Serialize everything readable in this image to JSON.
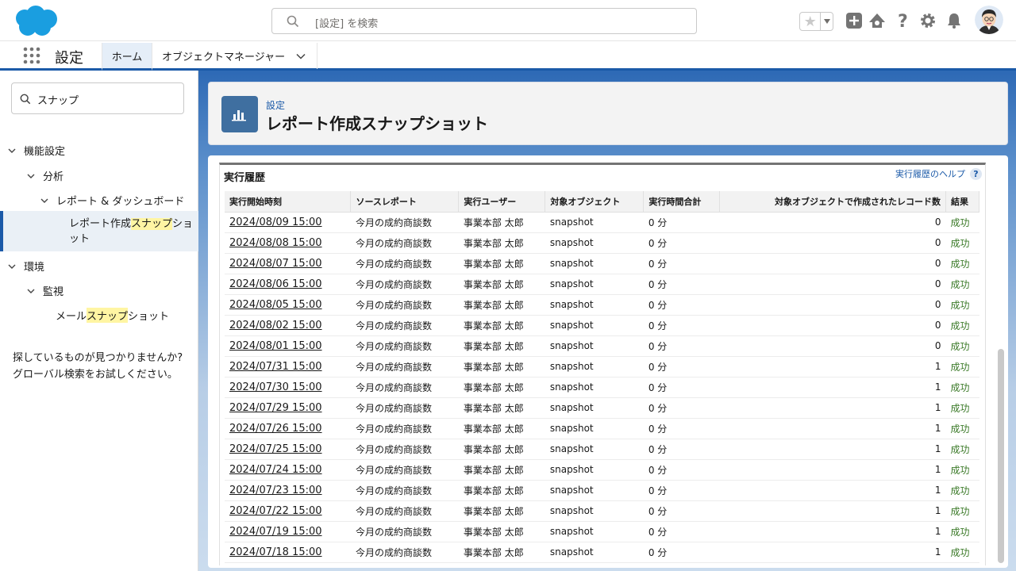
{
  "header": {
    "search_placeholder": "[設定] を検索"
  },
  "appnav": {
    "app_name": "設定",
    "tabs": [
      {
        "label": "ホーム"
      },
      {
        "label": "オブジェクトマネージャー"
      }
    ]
  },
  "sidebar": {
    "quick_find_value": "スナップ",
    "tree": {
      "features": "機能設定",
      "analytics": "分析",
      "reports_dashboards": "レポート & ダッシュボード",
      "selected_pre": "レポート作成",
      "selected_hl": "スナップ",
      "selected_post": "ショット",
      "environment": "環境",
      "monitoring": "監視",
      "email_pre": "メール",
      "email_hl": "スナップ",
      "email_post": "ショット"
    },
    "not_found_line1": "探しているものが見つかりませんか?",
    "not_found_line2": "グローバル検索をお試しください。"
  },
  "page": {
    "breadcrumb": "設定",
    "title": "レポート作成スナップショット"
  },
  "history": {
    "title": "実行履歴",
    "help_label": "実行履歴のヘルプ",
    "help_glyph": "?",
    "columns": [
      "実行開始時刻",
      "ソースレポート",
      "実行ユーザー",
      "対象オブジェクト",
      "実行時間合計",
      "対象オブジェクトで作成されたレコード数",
      "結果"
    ],
    "rows": [
      {
        "start": "2024/08/09 15:00",
        "report": "今月の成約商談数",
        "user": "事業本部 太郎",
        "object": "snapshot",
        "duration": "0 分",
        "records": "0",
        "result": "成功"
      },
      {
        "start": "2024/08/08 15:00",
        "report": "今月の成約商談数",
        "user": "事業本部 太郎",
        "object": "snapshot",
        "duration": "0 分",
        "records": "0",
        "result": "成功"
      },
      {
        "start": "2024/08/07 15:00",
        "report": "今月の成約商談数",
        "user": "事業本部 太郎",
        "object": "snapshot",
        "duration": "0 分",
        "records": "0",
        "result": "成功"
      },
      {
        "start": "2024/08/06 15:00",
        "report": "今月の成約商談数",
        "user": "事業本部 太郎",
        "object": "snapshot",
        "duration": "0 分",
        "records": "0",
        "result": "成功"
      },
      {
        "start": "2024/08/05 15:00",
        "report": "今月の成約商談数",
        "user": "事業本部 太郎",
        "object": "snapshot",
        "duration": "0 分",
        "records": "0",
        "result": "成功"
      },
      {
        "start": "2024/08/02 15:00",
        "report": "今月の成約商談数",
        "user": "事業本部 太郎",
        "object": "snapshot",
        "duration": "0 分",
        "records": "0",
        "result": "成功"
      },
      {
        "start": "2024/08/01 15:00",
        "report": "今月の成約商談数",
        "user": "事業本部 太郎",
        "object": "snapshot",
        "duration": "0 分",
        "records": "0",
        "result": "成功"
      },
      {
        "start": "2024/07/31 15:00",
        "report": "今月の成約商談数",
        "user": "事業本部 太郎",
        "object": "snapshot",
        "duration": "0 分",
        "records": "1",
        "result": "成功"
      },
      {
        "start": "2024/07/30 15:00",
        "report": "今月の成約商談数",
        "user": "事業本部 太郎",
        "object": "snapshot",
        "duration": "0 分",
        "records": "1",
        "result": "成功"
      },
      {
        "start": "2024/07/29 15:00",
        "report": "今月の成約商談数",
        "user": "事業本部 太郎",
        "object": "snapshot",
        "duration": "0 分",
        "records": "1",
        "result": "成功"
      },
      {
        "start": "2024/07/26 15:00",
        "report": "今月の成約商談数",
        "user": "事業本部 太郎",
        "object": "snapshot",
        "duration": "0 分",
        "records": "1",
        "result": "成功"
      },
      {
        "start": "2024/07/25 15:00",
        "report": "今月の成約商談数",
        "user": "事業本部 太郎",
        "object": "snapshot",
        "duration": "0 分",
        "records": "1",
        "result": "成功"
      },
      {
        "start": "2024/07/24 15:00",
        "report": "今月の成約商談数",
        "user": "事業本部 太郎",
        "object": "snapshot",
        "duration": "0 分",
        "records": "1",
        "result": "成功"
      },
      {
        "start": "2024/07/23 15:00",
        "report": "今月の成約商談数",
        "user": "事業本部 太郎",
        "object": "snapshot",
        "duration": "0 分",
        "records": "1",
        "result": "成功"
      },
      {
        "start": "2024/07/22 15:00",
        "report": "今月の成約商談数",
        "user": "事業本部 太郎",
        "object": "snapshot",
        "duration": "0 分",
        "records": "1",
        "result": "成功"
      },
      {
        "start": "2024/07/19 15:00",
        "report": "今月の成約商談数",
        "user": "事業本部 太郎",
        "object": "snapshot",
        "duration": "0 分",
        "records": "1",
        "result": "成功"
      },
      {
        "start": "2024/07/18 15:00",
        "report": "今月の成約商談数",
        "user": "事業本部 太郎",
        "object": "snapshot",
        "duration": "0 分",
        "records": "1",
        "result": "成功"
      }
    ]
  },
  "colors": {
    "brand": "#1b5aa8",
    "success": "#3b7a28",
    "highlight": "#fff5a3"
  },
  "icons": [
    "salesforce-cloud-logo",
    "search-icon",
    "star-icon",
    "chevron-down-icon",
    "add-icon",
    "trailhead-icon",
    "help-icon",
    "gear-icon",
    "bell-icon",
    "waffle-icon",
    "report-icon"
  ]
}
